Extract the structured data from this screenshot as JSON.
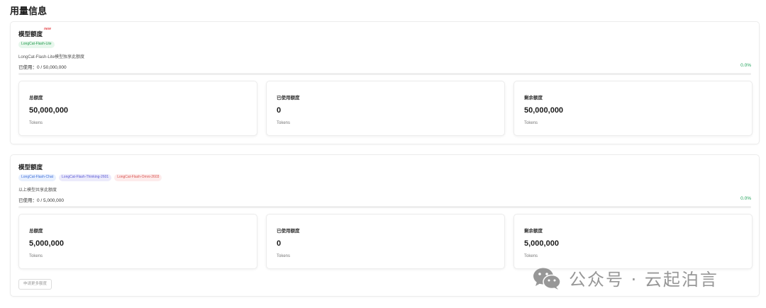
{
  "page": {
    "title": "用量信息"
  },
  "cards": [
    {
      "title": "模型额度",
      "badge": "new",
      "tags": [
        {
          "label": "LongCat-Flash-Lite",
          "color": "green"
        }
      ],
      "description": "LongCat-Flash-Lite模型独享此额度",
      "usage_text": "已使用：0 / 50,000,000",
      "usage_percent": "0.0%",
      "progress_fraction": 0.0,
      "stats": [
        {
          "label": "总额度",
          "value": "50,000,000",
          "unit": "Tokens"
        },
        {
          "label": "已使用额度",
          "value": "0",
          "unit": "Tokens"
        },
        {
          "label": "剩余额度",
          "value": "50,000,000",
          "unit": "Tokens"
        }
      ]
    },
    {
      "title": "模型额度",
      "tags": [
        {
          "label": "LongCat-Flash-Chat",
          "color": "blue"
        },
        {
          "label": "LongCat-Flash-Thinking-2601",
          "color": "purple"
        },
        {
          "label": "LongCat-Flash-Omni-2603",
          "color": "red"
        }
      ],
      "description": "以上模型共享此额度",
      "usage_text": "已使用：0 / 5,000,000",
      "usage_percent": "0.0%",
      "progress_fraction": 0.0,
      "stats": [
        {
          "label": "总额度",
          "value": "5,000,000",
          "unit": "Tokens"
        },
        {
          "label": "已使用额度",
          "value": "0",
          "unit": "Tokens"
        },
        {
          "label": "剩余额度",
          "value": "5,000,000",
          "unit": "Tokens"
        }
      ],
      "apply_button_label": "申请更多额度"
    }
  ],
  "watermark": {
    "text": "公众号 · 云起泊言",
    "icon": "wechat-icon"
  },
  "colors": {
    "accent_green": "#22a35a",
    "badge_red": "#e5484d"
  }
}
